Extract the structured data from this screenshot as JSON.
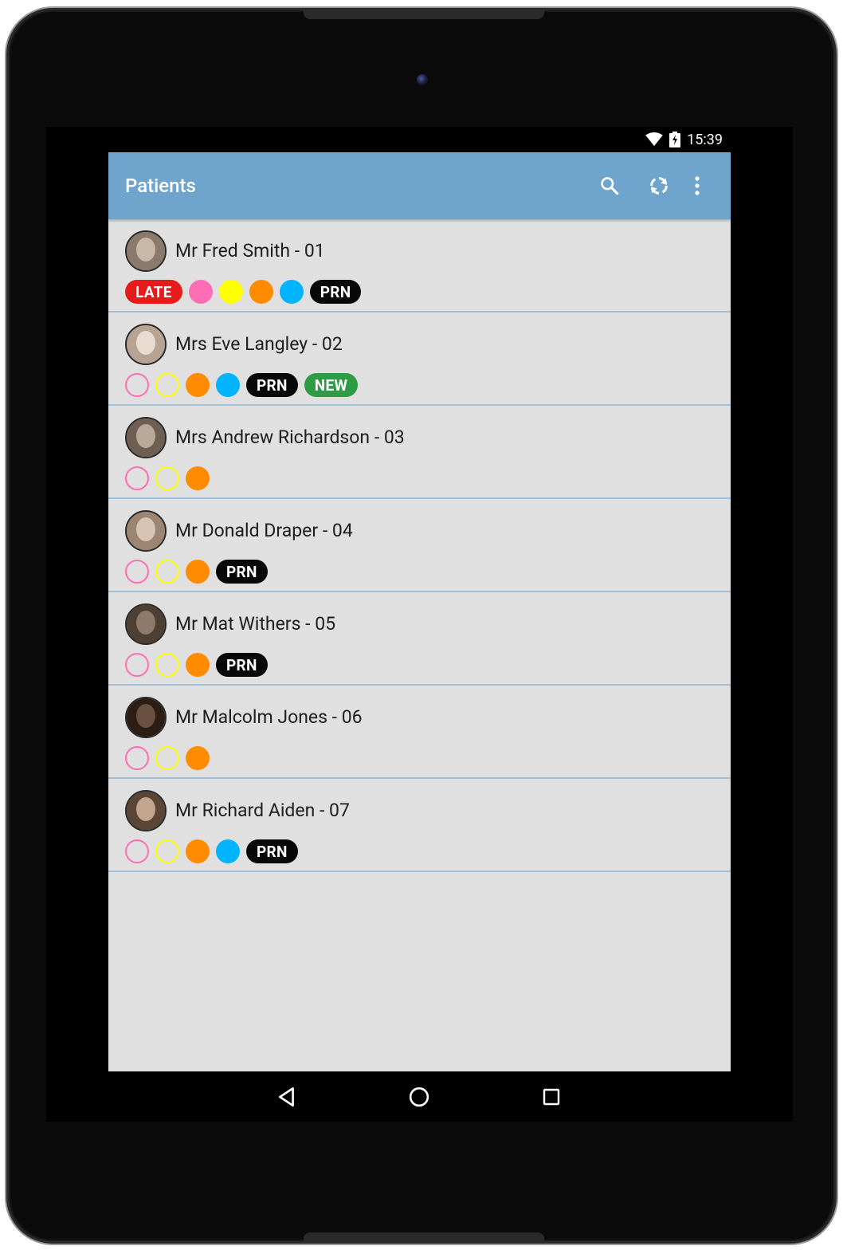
{
  "status_bar": {
    "time": "15:39",
    "icons": [
      "wifi-icon",
      "battery-icon"
    ]
  },
  "toolbar": {
    "title": "Patients",
    "actions": [
      "search-icon",
      "refresh-icon",
      "more-vert-icon"
    ]
  },
  "colors": {
    "toolbar": "#6fa5cc",
    "list_bg": "#e0e0e0",
    "divider": "#9fc0d9",
    "pink": "#ff6eb4",
    "yellow": "#ffff00",
    "orange": "#ff8c00",
    "blue": "#00b4ff",
    "late": "#e61b1b",
    "prn": "#080808",
    "new": "#2e9b45"
  },
  "patients": [
    {
      "name": "Mr Fred Smith - 01",
      "avatar": "avatar-photo",
      "tags": [
        {
          "type": "badge",
          "style": "late",
          "label": "LATE"
        },
        {
          "type": "dot",
          "color": "#ff6eb4",
          "filled": true
        },
        {
          "type": "dot",
          "color": "#ffff00",
          "filled": true
        },
        {
          "type": "dot",
          "color": "#ff8c00",
          "filled": true
        },
        {
          "type": "dot",
          "color": "#00b4ff",
          "filled": true
        },
        {
          "type": "badge",
          "style": "prn",
          "label": "PRN"
        }
      ]
    },
    {
      "name": "Mrs Eve Langley - 02",
      "avatar": "avatar-photo",
      "tags": [
        {
          "type": "dot",
          "color": "#ff6eb4",
          "filled": false
        },
        {
          "type": "dot",
          "color": "#ffff00",
          "filled": false
        },
        {
          "type": "dot",
          "color": "#ff8c00",
          "filled": true
        },
        {
          "type": "dot",
          "color": "#00b4ff",
          "filled": true
        },
        {
          "type": "badge",
          "style": "prn",
          "label": "PRN"
        },
        {
          "type": "badge",
          "style": "new",
          "label": "NEW"
        }
      ]
    },
    {
      "name": "Mrs Andrew Richardson - 03",
      "avatar": "avatar-photo",
      "tags": [
        {
          "type": "dot",
          "color": "#ff6eb4",
          "filled": false
        },
        {
          "type": "dot",
          "color": "#ffff00",
          "filled": false
        },
        {
          "type": "dot",
          "color": "#ff8c00",
          "filled": true
        }
      ]
    },
    {
      "name": "Mr Donald Draper - 04",
      "avatar": "avatar-photo",
      "tags": [
        {
          "type": "dot",
          "color": "#ff6eb4",
          "filled": false
        },
        {
          "type": "dot",
          "color": "#ffff00",
          "filled": false
        },
        {
          "type": "dot",
          "color": "#ff8c00",
          "filled": true
        },
        {
          "type": "badge",
          "style": "prn",
          "label": "PRN"
        }
      ]
    },
    {
      "name": "Mr Mat Withers - 05",
      "avatar": "avatar-photo",
      "tags": [
        {
          "type": "dot",
          "color": "#ff6eb4",
          "filled": false
        },
        {
          "type": "dot",
          "color": "#ffff00",
          "filled": false
        },
        {
          "type": "dot",
          "color": "#ff8c00",
          "filled": true
        },
        {
          "type": "badge",
          "style": "prn",
          "label": "PRN"
        }
      ]
    },
    {
      "name": "Mr Malcolm Jones - 06",
      "avatar": "avatar-photo",
      "tags": [
        {
          "type": "dot",
          "color": "#ff6eb4",
          "filled": false
        },
        {
          "type": "dot",
          "color": "#ffff00",
          "filled": false
        },
        {
          "type": "dot",
          "color": "#ff8c00",
          "filled": true
        }
      ]
    },
    {
      "name": "Mr Richard Aiden - 07",
      "avatar": "avatar-photo",
      "tags": [
        {
          "type": "dot",
          "color": "#ff6eb4",
          "filled": false
        },
        {
          "type": "dot",
          "color": "#ffff00",
          "filled": false
        },
        {
          "type": "dot",
          "color": "#ff8c00",
          "filled": true
        },
        {
          "type": "dot",
          "color": "#00b4ff",
          "filled": true
        },
        {
          "type": "badge",
          "style": "prn",
          "label": "PRN"
        }
      ]
    }
  ],
  "nav_bar": {
    "buttons": [
      "back-icon",
      "home-icon",
      "recents-icon"
    ]
  }
}
